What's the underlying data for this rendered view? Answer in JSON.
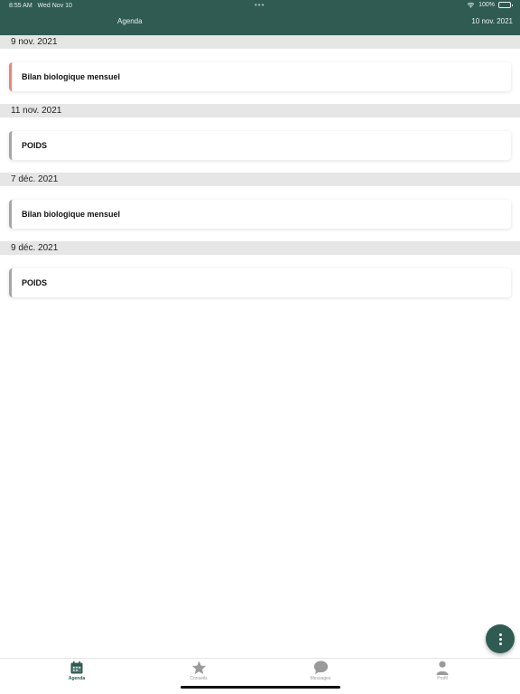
{
  "status_bar": {
    "time": "8:55 AM",
    "day": "Wed Nov 10",
    "battery": "100%"
  },
  "header": {
    "title": "Agenda",
    "current_date": "10 nov. 2021"
  },
  "sections": [
    {
      "date": "9 nov. 2021",
      "event": "Bilan biologique mensuel",
      "accent": "#e8857a"
    },
    {
      "date": "11 nov. 2021",
      "event": "POIDS",
      "accent": "#a6a6a6"
    },
    {
      "date": "7 déc. 2021",
      "event": "Bilan biologique mensuel",
      "accent": "#a6a6a6"
    },
    {
      "date": "9 déc. 2021",
      "event": "POIDS",
      "accent": "#a6a6a6"
    }
  ],
  "tabs": [
    {
      "label": "Agenda",
      "icon": "calendar-icon",
      "active": true
    },
    {
      "label": "Conseils",
      "icon": "star-icon",
      "active": false
    },
    {
      "label": "Messages",
      "icon": "chat-bubble-icon",
      "active": false
    },
    {
      "label": "Profil",
      "icon": "person-icon",
      "active": false
    }
  ],
  "fab": {
    "icon": "more-vertical-icon"
  },
  "colors": {
    "primary": "#2f5b53",
    "section_bg": "#e6e6e6",
    "accent_red": "#e8857a",
    "accent_gray": "#a6a6a6"
  }
}
